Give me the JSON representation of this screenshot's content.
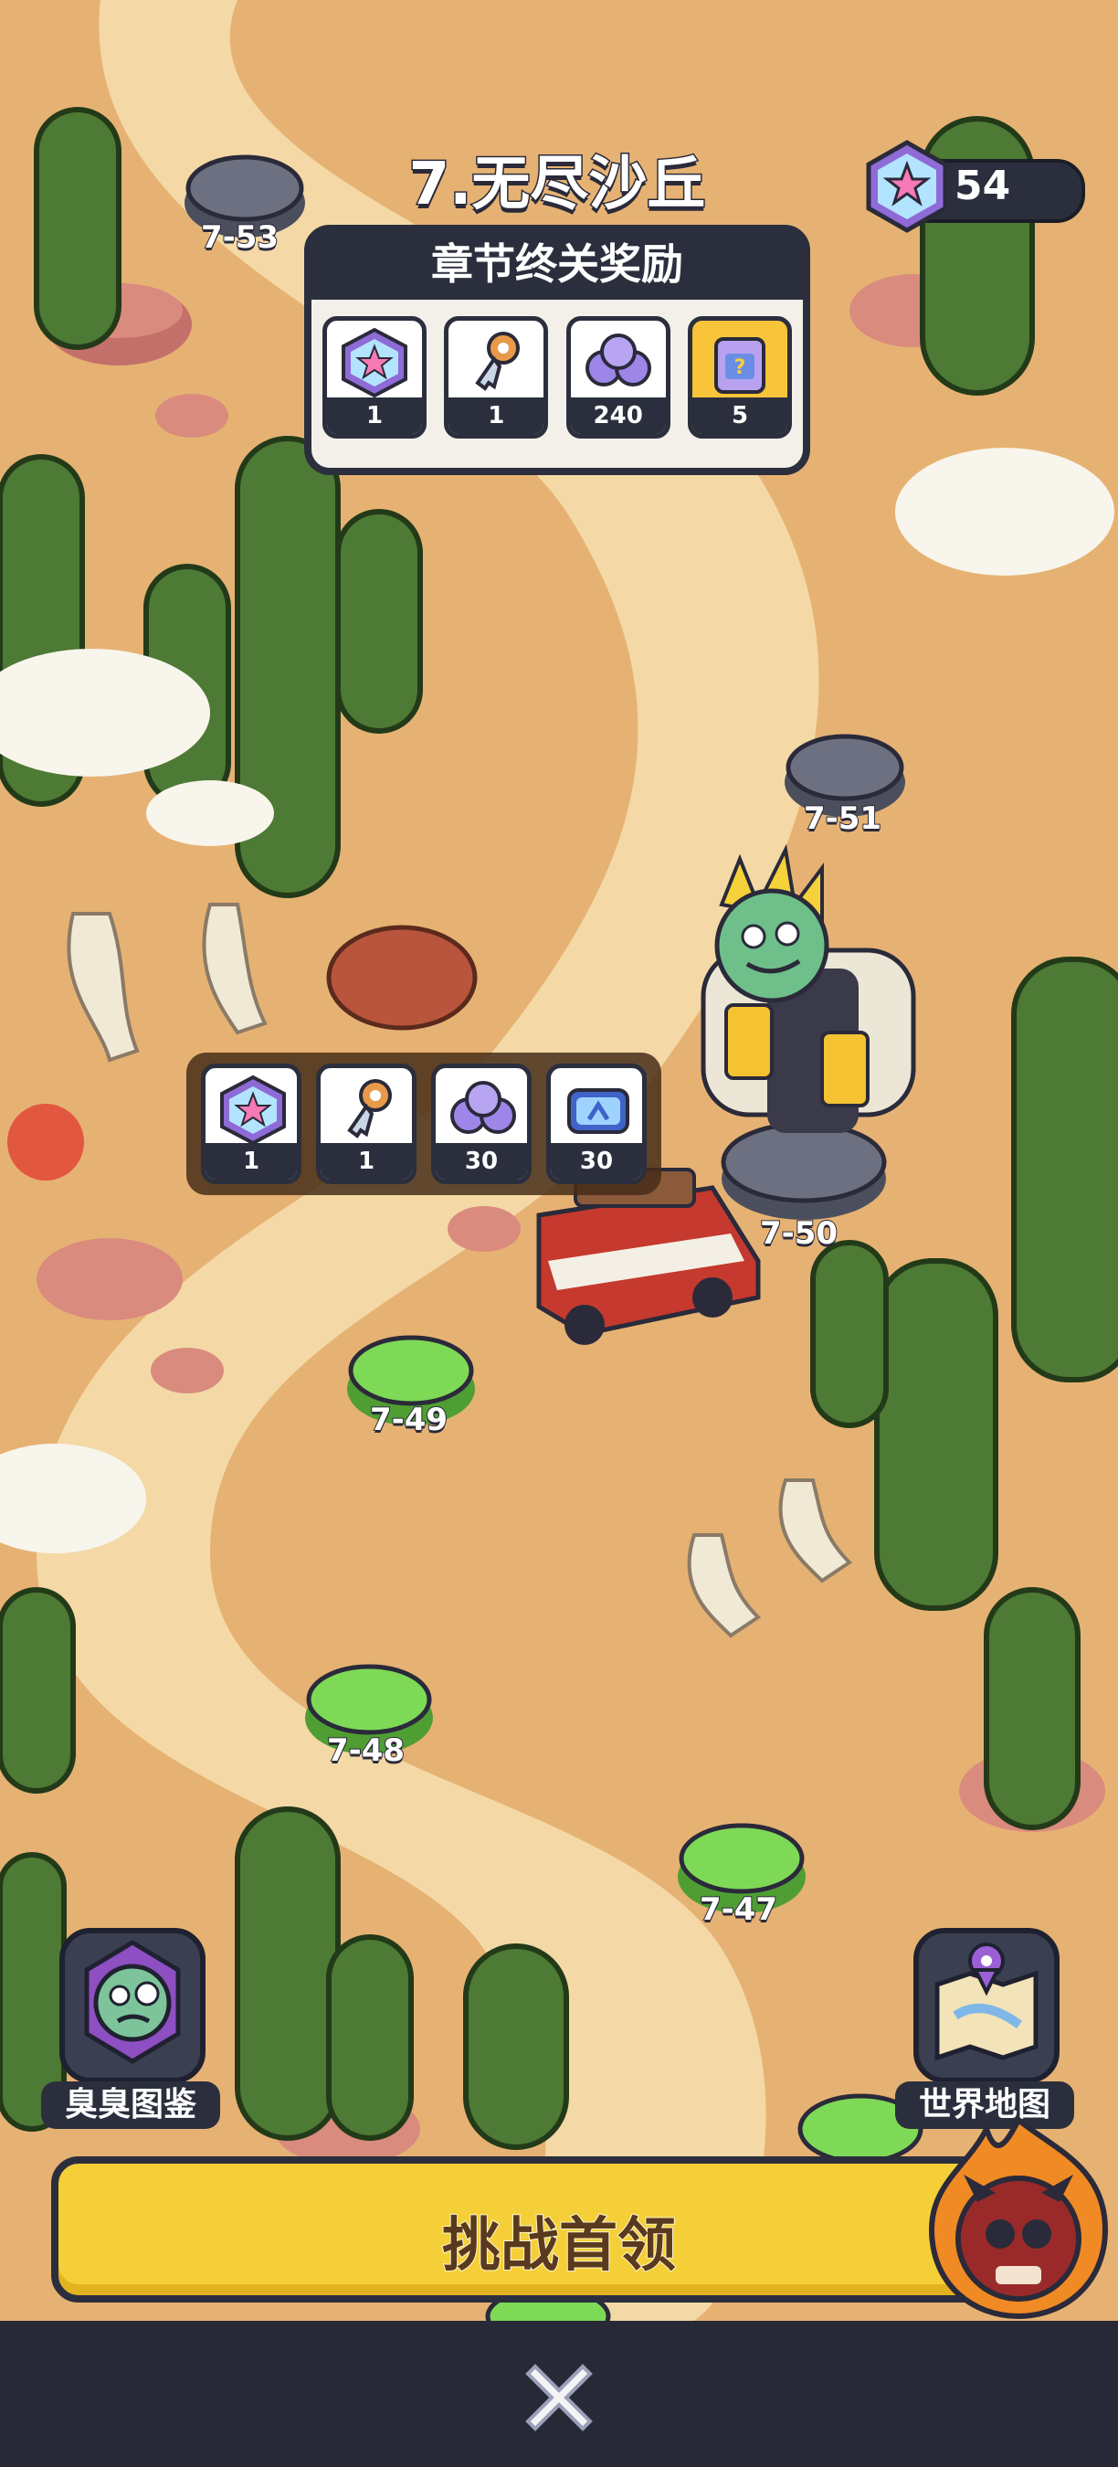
{
  "chapter_title": "7.无尽沙丘",
  "currency": {
    "value": "54",
    "icon": "star-gem-icon"
  },
  "chapter_reward": {
    "heading": "章节终关奖励",
    "items": [
      {
        "icon": "star-gem-icon",
        "count": "1"
      },
      {
        "icon": "key-icon",
        "count": "1"
      },
      {
        "icon": "orbs-icon",
        "count": "240"
      },
      {
        "icon": "mystery-box-icon",
        "count": "5"
      }
    ]
  },
  "stage_reward": {
    "items": [
      {
        "icon": "star-gem-icon",
        "count": "1"
      },
      {
        "icon": "key-icon",
        "count": "1"
      },
      {
        "icon": "orbs-icon",
        "count": "30"
      },
      {
        "icon": "ticket-icon",
        "count": "30"
      }
    ]
  },
  "stages": [
    {
      "label": "7-53",
      "state": "locked"
    },
    {
      "label": "7-51",
      "state": "locked"
    },
    {
      "label": "7-50",
      "state": "boss"
    },
    {
      "label": "7-49",
      "state": "cleared"
    },
    {
      "label": "7-48",
      "state": "cleared"
    },
    {
      "label": "7-47",
      "state": "cleared"
    }
  ],
  "buttons": {
    "bestiary": "臭臭图鉴",
    "world_map": "世界地图",
    "challenge": "挑战首领"
  },
  "colors": {
    "accent": "#f5cf37",
    "panel": "#2b2f3d",
    "cleared_node": "#7ed957",
    "locked_node": "#6d7080"
  }
}
